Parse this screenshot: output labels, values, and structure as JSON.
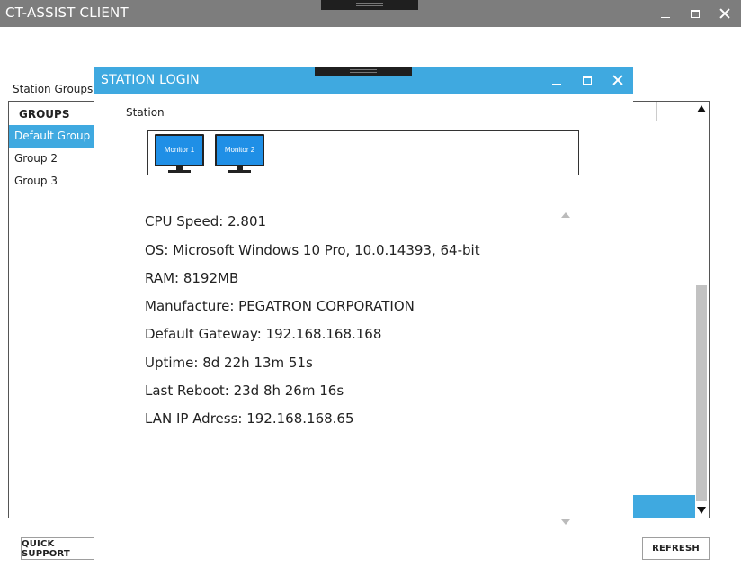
{
  "app": {
    "title": "CT-ASSIST CLIENT"
  },
  "groups_panel": {
    "label": "Station Groups",
    "header": "GROUPS",
    "items": [
      {
        "label": "Default Group",
        "selected": true
      },
      {
        "label": "Group 2",
        "selected": false
      },
      {
        "label": "Group 3",
        "selected": false
      }
    ]
  },
  "buttons": {
    "quick_support": "QUICK SUPPORT",
    "refresh": "REFRESH"
  },
  "dialog": {
    "title": "STATION LOGIN",
    "station_label": "Station",
    "monitors": [
      {
        "label": "Monitor 1"
      },
      {
        "label": "Monitor 2"
      }
    ],
    "info": [
      "CPU Speed: 2.801",
      "OS: Microsoft Windows 10 Pro, 10.0.14393, 64-bit",
      "RAM: 8192MB",
      "Manufacture: PEGATRON CORPORATION",
      "Default Gateway: 192.168.168.168",
      "Uptime: 8d 22h 13m 51s",
      "Last Reboot: 23d 8h 26m 16s",
      "LAN IP Adress: 192.168.168.65"
    ]
  },
  "colors": {
    "accent": "#3fa9e0",
    "main_titlebar": "#7d7d7d",
    "monitor_screen": "#1f8fe6"
  },
  "icons": {
    "minimize": "minimize-icon",
    "maximize": "maximize-icon",
    "close": "close-icon",
    "monitor": "monitor-icon"
  }
}
